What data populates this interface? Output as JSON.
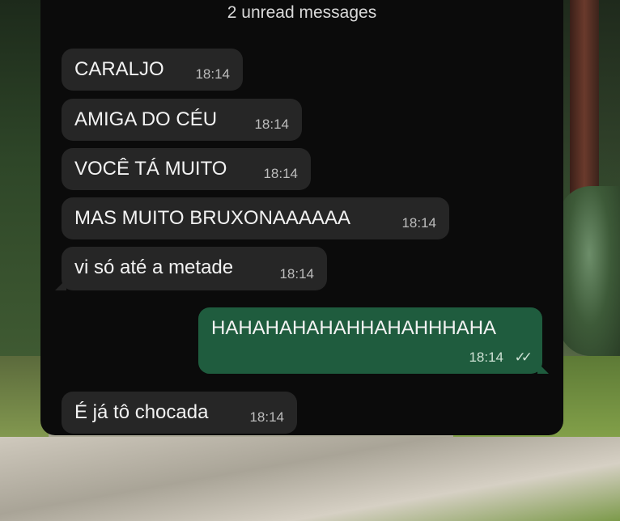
{
  "banner": {
    "unread": "2 unread messages"
  },
  "messages": [
    {
      "direction": "in",
      "text": "CARALJO",
      "time": "18:14"
    },
    {
      "direction": "in",
      "text": "AMIGA DO CÉU",
      "time": "18:14"
    },
    {
      "direction": "in",
      "text": "VOCÊ TÁ MUITO",
      "time": "18:14"
    },
    {
      "direction": "in",
      "text": "MAS MUITO BRUXONAAAAAA",
      "time": "18:14"
    },
    {
      "direction": "in",
      "text": "vi só até a metade",
      "time": "18:14"
    },
    {
      "direction": "out",
      "text": "HAHAHAHAHAHHAHAHHHAHA",
      "time": "18:14",
      "status": "read"
    },
    {
      "direction": "in",
      "text": "É já tô chocada",
      "time": "18:14"
    }
  ],
  "icons": {
    "read_receipt": "double-check-icon"
  },
  "colors": {
    "panel_bg": "#0b0b0b",
    "incoming_bubble": "#262626",
    "outgoing_bubble": "#1f5c3e",
    "text": "#f2f2f2",
    "timestamp": "#bdbdbd"
  }
}
